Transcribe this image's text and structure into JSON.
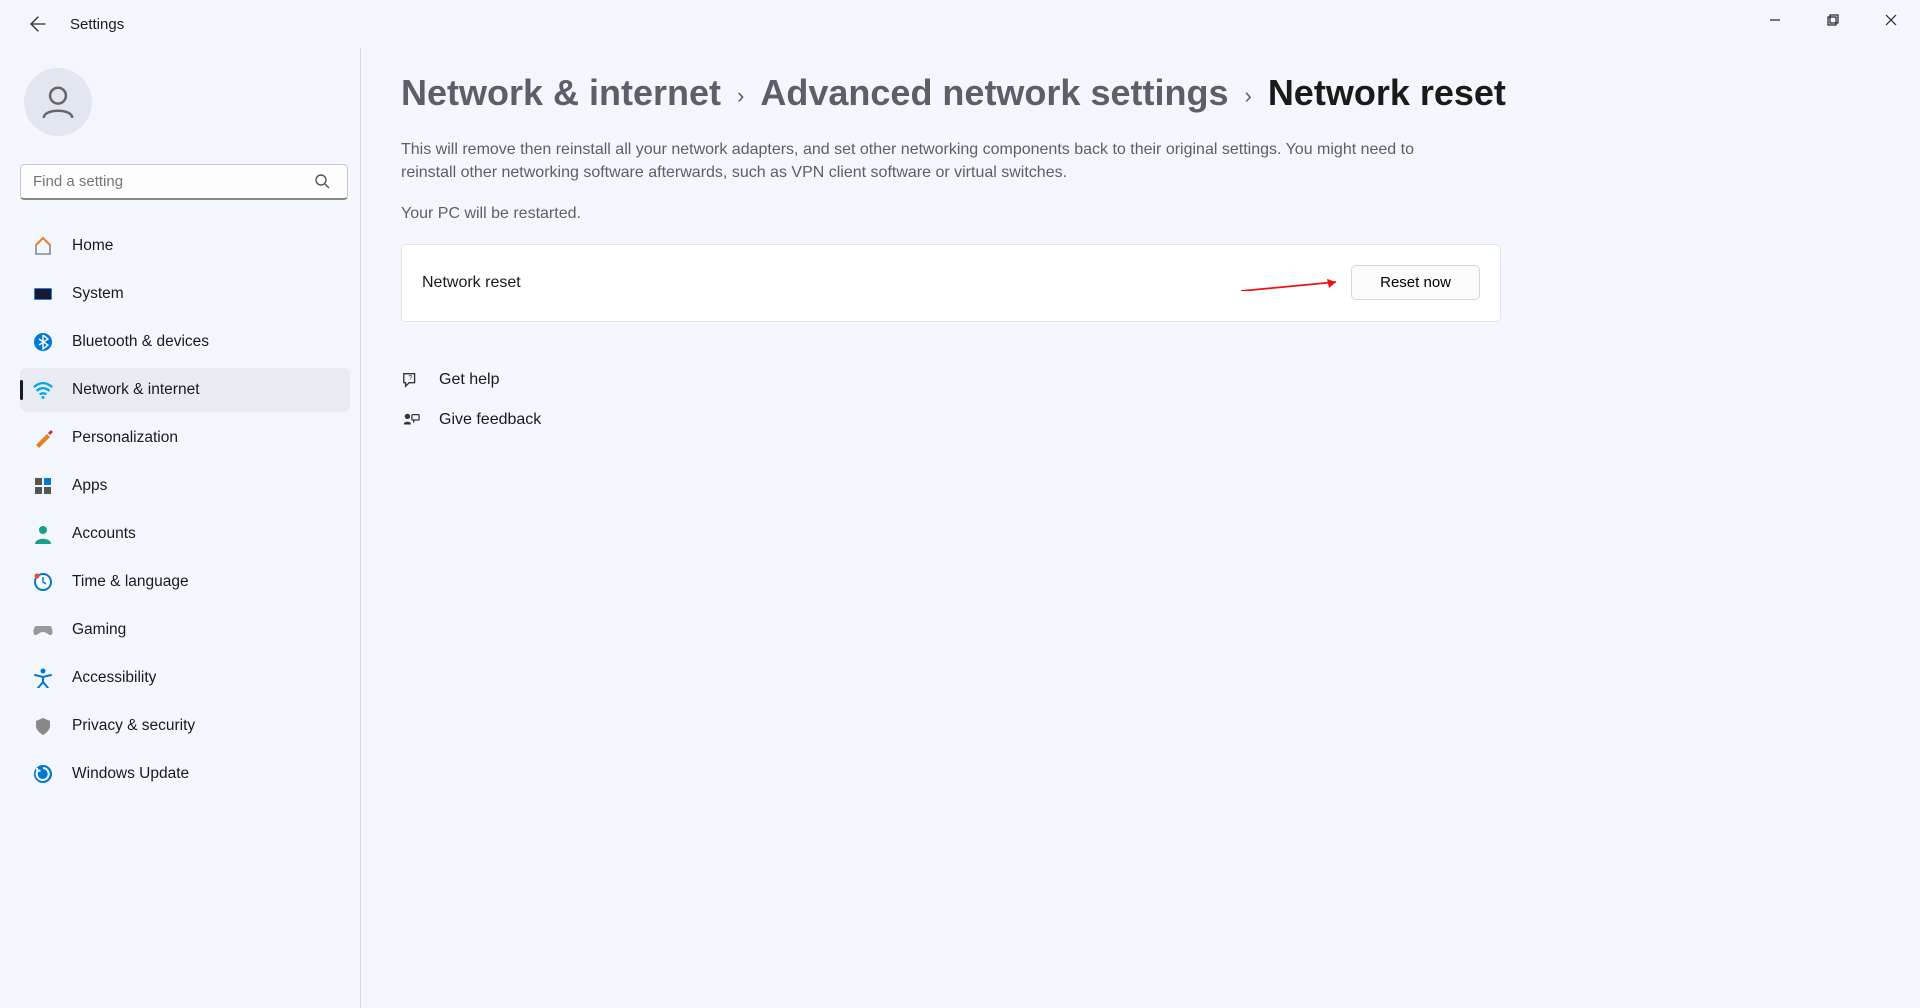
{
  "app_title": "Settings",
  "search": {
    "placeholder": "Find a setting"
  },
  "sidebar": {
    "items": [
      {
        "label": "Home",
        "icon": "home-icon"
      },
      {
        "label": "System",
        "icon": "system-icon"
      },
      {
        "label": "Bluetooth & devices",
        "icon": "bluetooth-icon"
      },
      {
        "label": "Network & internet",
        "icon": "wifi-icon",
        "active": true
      },
      {
        "label": "Personalization",
        "icon": "personalization-icon"
      },
      {
        "label": "Apps",
        "icon": "apps-icon"
      },
      {
        "label": "Accounts",
        "icon": "accounts-icon"
      },
      {
        "label": "Time & language",
        "icon": "time-icon"
      },
      {
        "label": "Gaming",
        "icon": "gaming-icon"
      },
      {
        "label": "Accessibility",
        "icon": "accessibility-icon"
      },
      {
        "label": "Privacy & security",
        "icon": "privacy-icon"
      },
      {
        "label": "Windows Update",
        "icon": "update-icon"
      }
    ]
  },
  "breadcrumb": {
    "part1": "Network & internet",
    "part2": "Advanced network settings",
    "current": "Network reset"
  },
  "description": "This will remove then reinstall all your network adapters, and set other networking components back to their original settings. You might need to reinstall other networking software afterwards, such as VPN client software or virtual switches.",
  "restart_note": "Your PC will be restarted.",
  "card": {
    "label": "Network reset",
    "button": "Reset now"
  },
  "links": {
    "help": "Get help",
    "feedback": "Give feedback"
  }
}
